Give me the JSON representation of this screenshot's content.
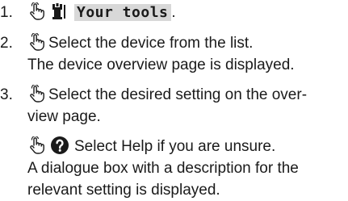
{
  "steps": [
    {
      "number": "1.",
      "ui_element": "Your tools",
      "suffix": ".",
      "icons": [
        "hand-tap-icon",
        "tools-icon"
      ]
    },
    {
      "number": "2.",
      "action": "Select the device from the list.",
      "result": "The device overview page is displayed.",
      "icons": [
        "hand-tap-icon"
      ]
    },
    {
      "number": "3.",
      "action_line1": "Select the desired setting on the over-",
      "action_line2": "view page.",
      "icons": [
        "hand-tap-icon"
      ],
      "substep": {
        "action": "Select Help if you are unsure.",
        "result_line1": "A dialogue box with a description for the",
        "result_line2": "relevant setting is displayed.",
        "icons": [
          "hand-tap-icon",
          "help-icon"
        ]
      }
    }
  ]
}
